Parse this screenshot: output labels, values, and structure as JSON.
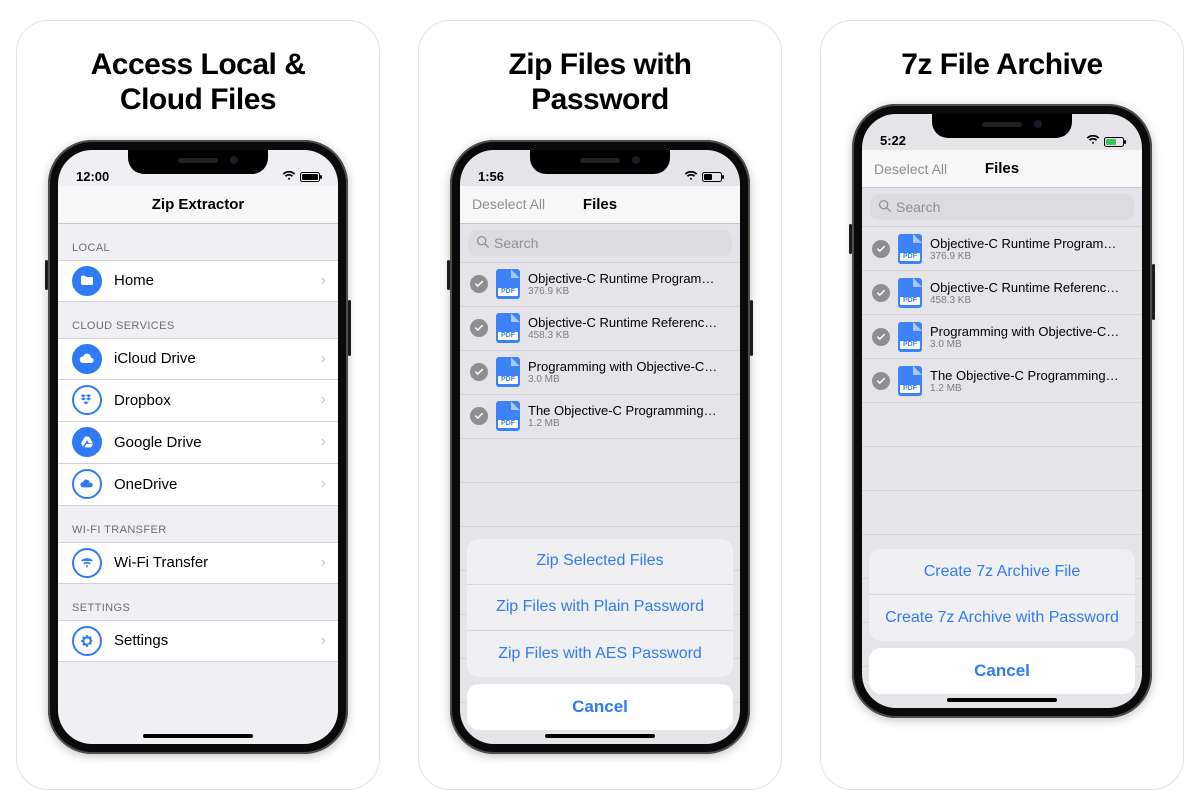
{
  "panels": [
    {
      "title": "Access Local &\nCloud Files"
    },
    {
      "title": "Zip Files with\nPassword"
    },
    {
      "title": "7z File Archive"
    }
  ],
  "screen1": {
    "time": "12:00",
    "nav_title": "Zip Extractor",
    "sections": [
      {
        "header": "LOCAL",
        "rows": [
          {
            "label": "Home"
          }
        ]
      },
      {
        "header": "CLOUD SERVICES",
        "rows": [
          {
            "label": "iCloud Drive"
          },
          {
            "label": "Dropbox"
          },
          {
            "label": "Google Drive"
          },
          {
            "label": "OneDrive"
          }
        ]
      },
      {
        "header": "WI-FI TRANSFER",
        "rows": [
          {
            "label": "Wi-Fi Transfer"
          }
        ]
      },
      {
        "header": "SETTINGS",
        "rows": [
          {
            "label": "Settings"
          }
        ]
      }
    ]
  },
  "screen2": {
    "time": "1:56",
    "nav_left": "Deselect All",
    "nav_title": "Files",
    "search_placeholder": "Search",
    "files": [
      {
        "name": "Objective-C Runtime Programmin...",
        "size": "376.9 KB"
      },
      {
        "name": "Objective-C Runtime Reference.pdf",
        "size": "458.3 KB"
      },
      {
        "name": "Programming with Objective-C.pdf",
        "size": "3.0 MB"
      },
      {
        "name": "The Objective-C Programming Lan...",
        "size": "1.2 MB"
      }
    ],
    "actions": [
      "Zip Selected Files",
      "Zip Files with Plain Password",
      "Zip Files with AES Password"
    ],
    "cancel": "Cancel"
  },
  "screen3": {
    "time": "5:22",
    "nav_left": "Deselect All",
    "nav_title": "Files",
    "search_placeholder": "Search",
    "files": [
      {
        "name": "Objective-C Runtime Programmin...",
        "size": "376.9 KB"
      },
      {
        "name": "Objective-C Runtime Reference.pdf",
        "size": "458.3 KB"
      },
      {
        "name": "Programming with Objective-C.pdf",
        "size": "3.0 MB"
      },
      {
        "name": "The Objective-C Programming Lan...",
        "size": "1.2 MB"
      }
    ],
    "actions": [
      "Create 7z Archive File",
      "Create 7z Archive with Password"
    ],
    "cancel": "Cancel"
  }
}
